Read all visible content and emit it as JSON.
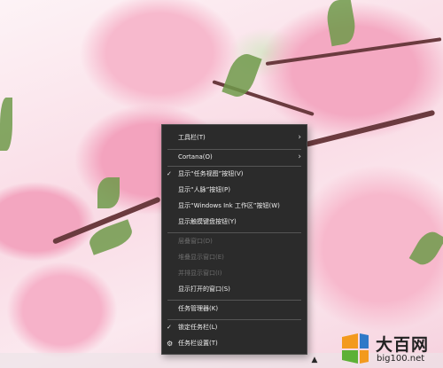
{
  "context_menu": {
    "items": [
      {
        "label": "工具栏(T)",
        "checked": false,
        "submenu": true,
        "enabled": true
      },
      {
        "label": "Cortana(O)",
        "checked": false,
        "submenu": true,
        "enabled": true
      },
      {
        "label": "显示“任务视图”按钮(V)",
        "checked": true,
        "submenu": false,
        "enabled": true
      },
      {
        "label": "显示“人脉”按钮(P)",
        "checked": false,
        "submenu": false,
        "enabled": true
      },
      {
        "label": "显示“Windows Ink 工作区”按钮(W)",
        "checked": false,
        "submenu": false,
        "enabled": true
      },
      {
        "label": "显示触摸键盘按钮(Y)",
        "checked": false,
        "submenu": false,
        "enabled": true
      },
      {
        "label": "层叠窗口(D)",
        "checked": false,
        "submenu": false,
        "enabled": false
      },
      {
        "label": "堆叠显示窗口(E)",
        "checked": false,
        "submenu": false,
        "enabled": false
      },
      {
        "label": "并排显示窗口(I)",
        "checked": false,
        "submenu": false,
        "enabled": false
      },
      {
        "label": "显示打开的窗口(S)",
        "checked": false,
        "submenu": false,
        "enabled": true
      },
      {
        "label": "任务管理器(K)",
        "checked": false,
        "submenu": false,
        "enabled": true
      },
      {
        "label": "锁定任务栏(L)",
        "checked": true,
        "submenu": false,
        "enabled": true
      },
      {
        "label": "任务栏设置(T)",
        "checked": false,
        "submenu": false,
        "enabled": true,
        "icon": "gear-icon"
      }
    ]
  },
  "watermark": {
    "title": "大百网",
    "url": "big100.net"
  },
  "colors": {
    "menu_background": "#2b2b2b",
    "menu_text": "#f0f0f0",
    "menu_text_disabled": "#6c6c6c",
    "logo_orange": "#f39a1e",
    "logo_blue": "#2f79c8",
    "logo_green": "#5db136"
  }
}
